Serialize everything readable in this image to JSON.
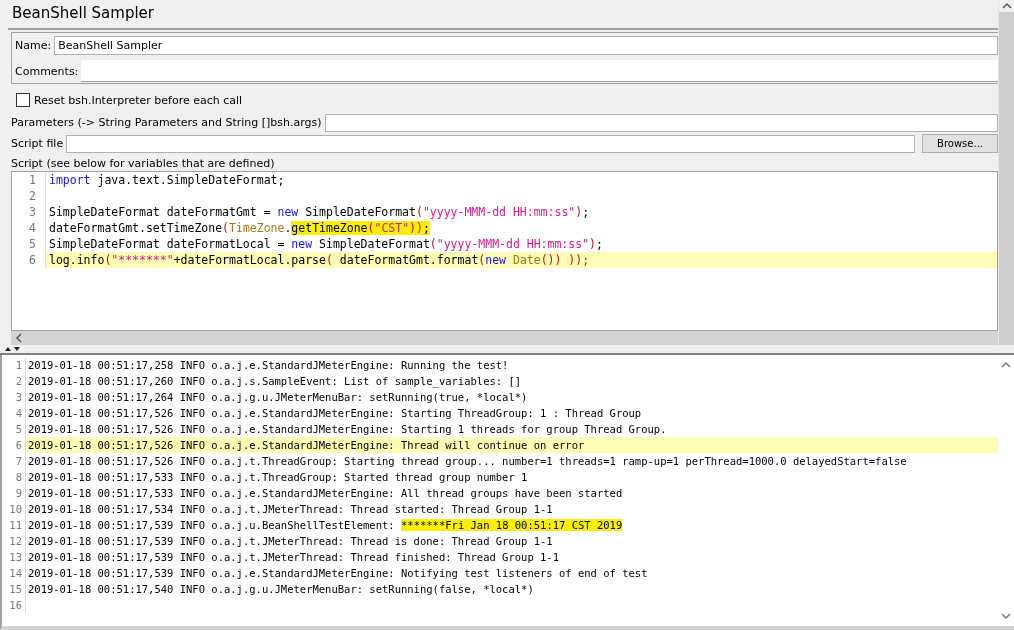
{
  "title": "BeanShell Sampler",
  "name_field": {
    "label": "Name:",
    "value": "BeanShell Sampler"
  },
  "comments_field": {
    "label": "Comments:"
  },
  "reset_checkbox": {
    "label": "Reset bsh.Interpreter before each call",
    "checked": false
  },
  "parameters_field": {
    "label": "Parameters (-> String Parameters and String []bsh.args)"
  },
  "script_file": {
    "label": "Script file",
    "button": "Browse..."
  },
  "script_label": "Script (see below for variables that are defined)",
  "code_lines": [
    {
      "number": "1",
      "current": false,
      "tokens": [
        {
          "kind": "keyword",
          "text": "import",
          "highlighted": false
        },
        {
          "kind": "plain",
          "text": " java.text.SimpleDateFormat;",
          "highlighted": false
        }
      ]
    },
    {
      "number": "2",
      "current": false
    },
    {
      "number": "3",
      "current": false,
      "tokens": [
        {
          "kind": "plain",
          "text": "SimpleDateFormat dateFormatGmt = ",
          "highlighted": false
        },
        {
          "kind": "keyword",
          "text": "new",
          "highlighted": false
        },
        {
          "kind": "plain",
          "text": " SimpleDateFormat",
          "highlighted": false
        },
        {
          "kind": "paren",
          "text": "(",
          "highlighted": false
        },
        {
          "kind": "string",
          "text": "\"yyyy-MMM-dd HH:mm:ss\"",
          "highlighted": false
        },
        {
          "kind": "paren",
          "text": ")",
          "highlighted": false
        },
        {
          "kind": "plain",
          "text": ";",
          "highlighted": false
        }
      ]
    },
    {
      "number": "4",
      "current": false,
      "tokens": [
        {
          "kind": "plain",
          "text": "dateFormatGmt.setTimeZone",
          "highlighted": false
        },
        {
          "kind": "paren",
          "text": "(",
          "highlighted": false
        },
        {
          "kind": "type",
          "text": "TimeZone",
          "highlighted": false
        },
        {
          "kind": "plain",
          "text": ".",
          "highlighted": false
        },
        {
          "kind": "plain",
          "text": "getTimeZone",
          "highlighted": true
        },
        {
          "kind": "paren",
          "text": "(",
          "highlighted": true
        },
        {
          "kind": "string",
          "text": "\"CST\"",
          "highlighted": true
        },
        {
          "kind": "paren",
          "text": "))",
          "highlighted": true
        },
        {
          "kind": "plain",
          "text": ";",
          "highlighted": true
        }
      ]
    },
    {
      "number": "5",
      "current": false,
      "tokens": [
        {
          "kind": "plain",
          "text": "SimpleDateFormat dateFormatLocal = ",
          "highlighted": false
        },
        {
          "kind": "keyword",
          "text": "new",
          "highlighted": false
        },
        {
          "kind": "plain",
          "text": " SimpleDateFormat",
          "highlighted": false
        },
        {
          "kind": "paren",
          "text": "(",
          "highlighted": false
        },
        {
          "kind": "string",
          "text": "\"yyyy-MMM-dd HH:mm:ss\"",
          "highlighted": false
        },
        {
          "kind": "paren",
          "text": ")",
          "highlighted": false
        },
        {
          "kind": "plain",
          "text": ";",
          "highlighted": false
        }
      ]
    },
    {
      "number": "6",
      "current": true,
      "tokens": [
        {
          "kind": "plain",
          "text": "log.info",
          "highlighted": false
        },
        {
          "kind": "paren",
          "text": "(",
          "highlighted": false
        },
        {
          "kind": "string",
          "text": "\"*******\"",
          "highlighted": false
        },
        {
          "kind": "plain",
          "text": "+dateFormatLocal.parse",
          "highlighted": false
        },
        {
          "kind": "paren",
          "text": "(",
          "highlighted": false
        },
        {
          "kind": "plain",
          "text": " dateFormatGmt.format",
          "highlighted": false
        },
        {
          "kind": "paren",
          "text": "(",
          "highlighted": false
        },
        {
          "kind": "keyword",
          "text": "new",
          "highlighted": false
        },
        {
          "kind": "type",
          "text": " Date",
          "highlighted": false
        },
        {
          "kind": "paren",
          "text": "()) ));",
          "highlighted": false
        }
      ]
    }
  ],
  "log_lines": [
    {
      "number": "1",
      "current": false,
      "segments": [
        {
          "text": "2019-01-18 00:51:17,258 INFO o.a.j.e.StandardJMeterEngine: Running the test!",
          "highlighted": false
        }
      ]
    },
    {
      "number": "2",
      "current": false,
      "segments": [
        {
          "text": "2019-01-18 00:51:17,260 INFO o.a.j.s.SampleEvent: List of sample_variables: []",
          "highlighted": false
        }
      ]
    },
    {
      "number": "3",
      "current": false,
      "segments": [
        {
          "text": "2019-01-18 00:51:17,264 INFO o.a.j.g.u.JMeterMenuBar: setRunning(true, *local*)",
          "highlighted": false
        }
      ]
    },
    {
      "number": "4",
      "current": false,
      "segments": [
        {
          "text": "2019-01-18 00:51:17,526 INFO o.a.j.e.StandardJMeterEngine: Starting ThreadGroup: 1 : Thread Group",
          "highlighted": false
        }
      ]
    },
    {
      "number": "5",
      "current": false,
      "segments": [
        {
          "text": "2019-01-18 00:51:17,526 INFO o.a.j.e.StandardJMeterEngine: Starting 1 threads for group Thread Group.",
          "highlighted": false
        }
      ]
    },
    {
      "number": "6",
      "current": true,
      "segments": [
        {
          "text": "2019-01-18 00:51:17,526 INFO o.a.j.e.StandardJMeterEngine: Thread will continue on error",
          "highlighted": false
        }
      ]
    },
    {
      "number": "7",
      "current": false,
      "segments": [
        {
          "text": "2019-01-18 00:51:17,526 INFO o.a.j.t.ThreadGroup: Starting thread group... number=1 threads=1 ramp-up=1 perThread=1000.0 delayedStart=false",
          "highlighted": false
        }
      ]
    },
    {
      "number": "8",
      "current": false,
      "segments": [
        {
          "text": "2019-01-18 00:51:17,533 INFO o.a.j.t.ThreadGroup: Started thread group number 1",
          "highlighted": false
        }
      ]
    },
    {
      "number": "9",
      "current": false,
      "segments": [
        {
          "text": "2019-01-18 00:51:17,533 INFO o.a.j.e.StandardJMeterEngine: All thread groups have been started",
          "highlighted": false
        }
      ]
    },
    {
      "number": "10",
      "current": false,
      "segments": [
        {
          "text": "2019-01-18 00:51:17,534 INFO o.a.j.t.JMeterThread: Thread started: Thread Group 1-1",
          "highlighted": false
        }
      ]
    },
    {
      "number": "11",
      "current": false,
      "segments": [
        {
          "text": "2019-01-18 00:51:17,539 INFO o.a.j.u.BeanShellTestElement: ",
          "highlighted": false
        },
        {
          "text": "*******Fri Jan 18 00:51:17 CST 2019",
          "highlighted": true
        }
      ]
    },
    {
      "number": "12",
      "current": false,
      "segments": [
        {
          "text": "2019-01-18 00:51:17,539 INFO o.a.j.t.JMeterThread: Thread is done: Thread Group 1-1",
          "highlighted": false
        }
      ]
    },
    {
      "number": "13",
      "current": false,
      "segments": [
        {
          "text": "2019-01-18 00:51:17,539 INFO o.a.j.t.JMeterThread: Thread finished: Thread Group 1-1",
          "highlighted": false
        }
      ]
    },
    {
      "number": "14",
      "current": false,
      "segments": [
        {
          "text": "2019-01-18 00:51:17,539 INFO o.a.j.e.StandardJMeterEngine: Notifying test listeners of end of test",
          "highlighted": false
        }
      ]
    },
    {
      "number": "15",
      "current": false,
      "segments": [
        {
          "text": "2019-01-18 00:51:17,540 INFO o.a.j.g.u.JMeterMenuBar: setRunning(false, *local*)",
          "highlighted": false
        }
      ]
    },
    {
      "number": "16",
      "current": false
    }
  ]
}
